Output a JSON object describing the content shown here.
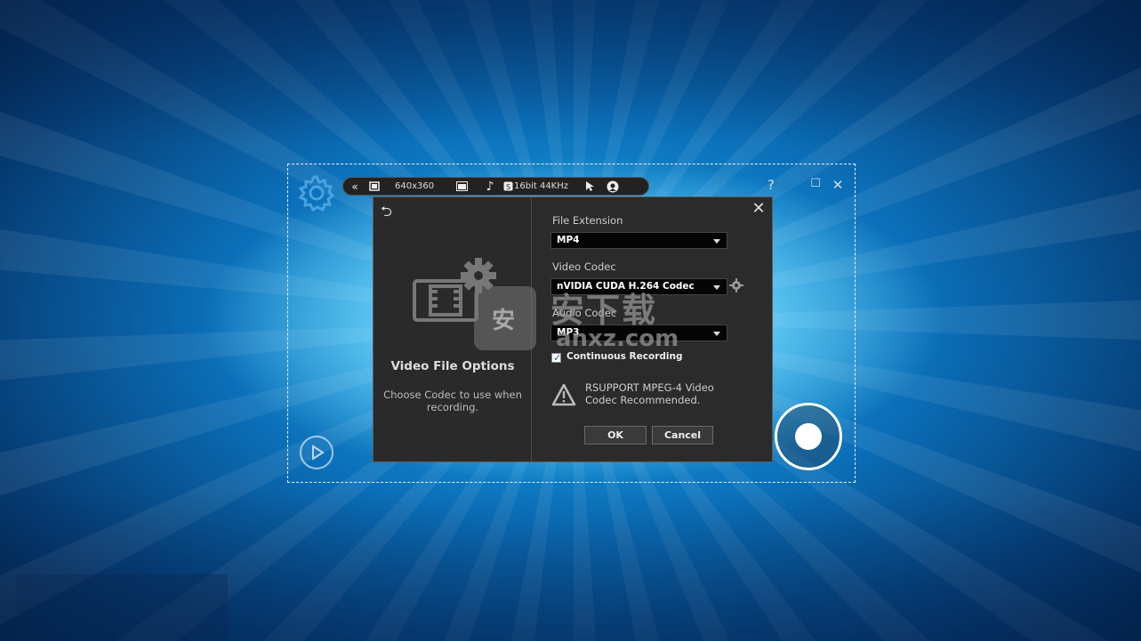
{
  "toolbar": {
    "resolution": "640x360",
    "audio_format": "16bit 44KHz",
    "icons": [
      "collapse-icon",
      "screen-size-icon",
      "overlay-icon",
      "music-note-icon",
      "audio-source-icon",
      "cursor-icon",
      "webcam-icon"
    ]
  },
  "window_controls": {
    "help": "?",
    "maximize": "☐",
    "close": "✕"
  },
  "dialog": {
    "back": "⮌",
    "close": "✕",
    "left_title": "Video File Options",
    "left_desc": "Choose Codec to use when recording.",
    "file_extension_label": "File Extension",
    "file_extension_value": "MP4",
    "video_codec_label": "Video Codec",
    "video_codec_value": "nVIDIA CUDA H.264 Codec",
    "audio_codec_label": "Audio Codec",
    "audio_codec_value": "MP3",
    "continuous_recording_label": "Continuous Recording",
    "continuous_recording_checked": true,
    "warning_text": "RSUPPORT MPEG-4 Video Codec Recommended.",
    "ok_label": "OK",
    "cancel_label": "Cancel"
  },
  "watermark": {
    "glyph": "安",
    "text": "安下载",
    "url": "anxz.com"
  },
  "colors": {
    "dialog_bg": "#2b2b2b",
    "accent": "#1aa6e8"
  }
}
